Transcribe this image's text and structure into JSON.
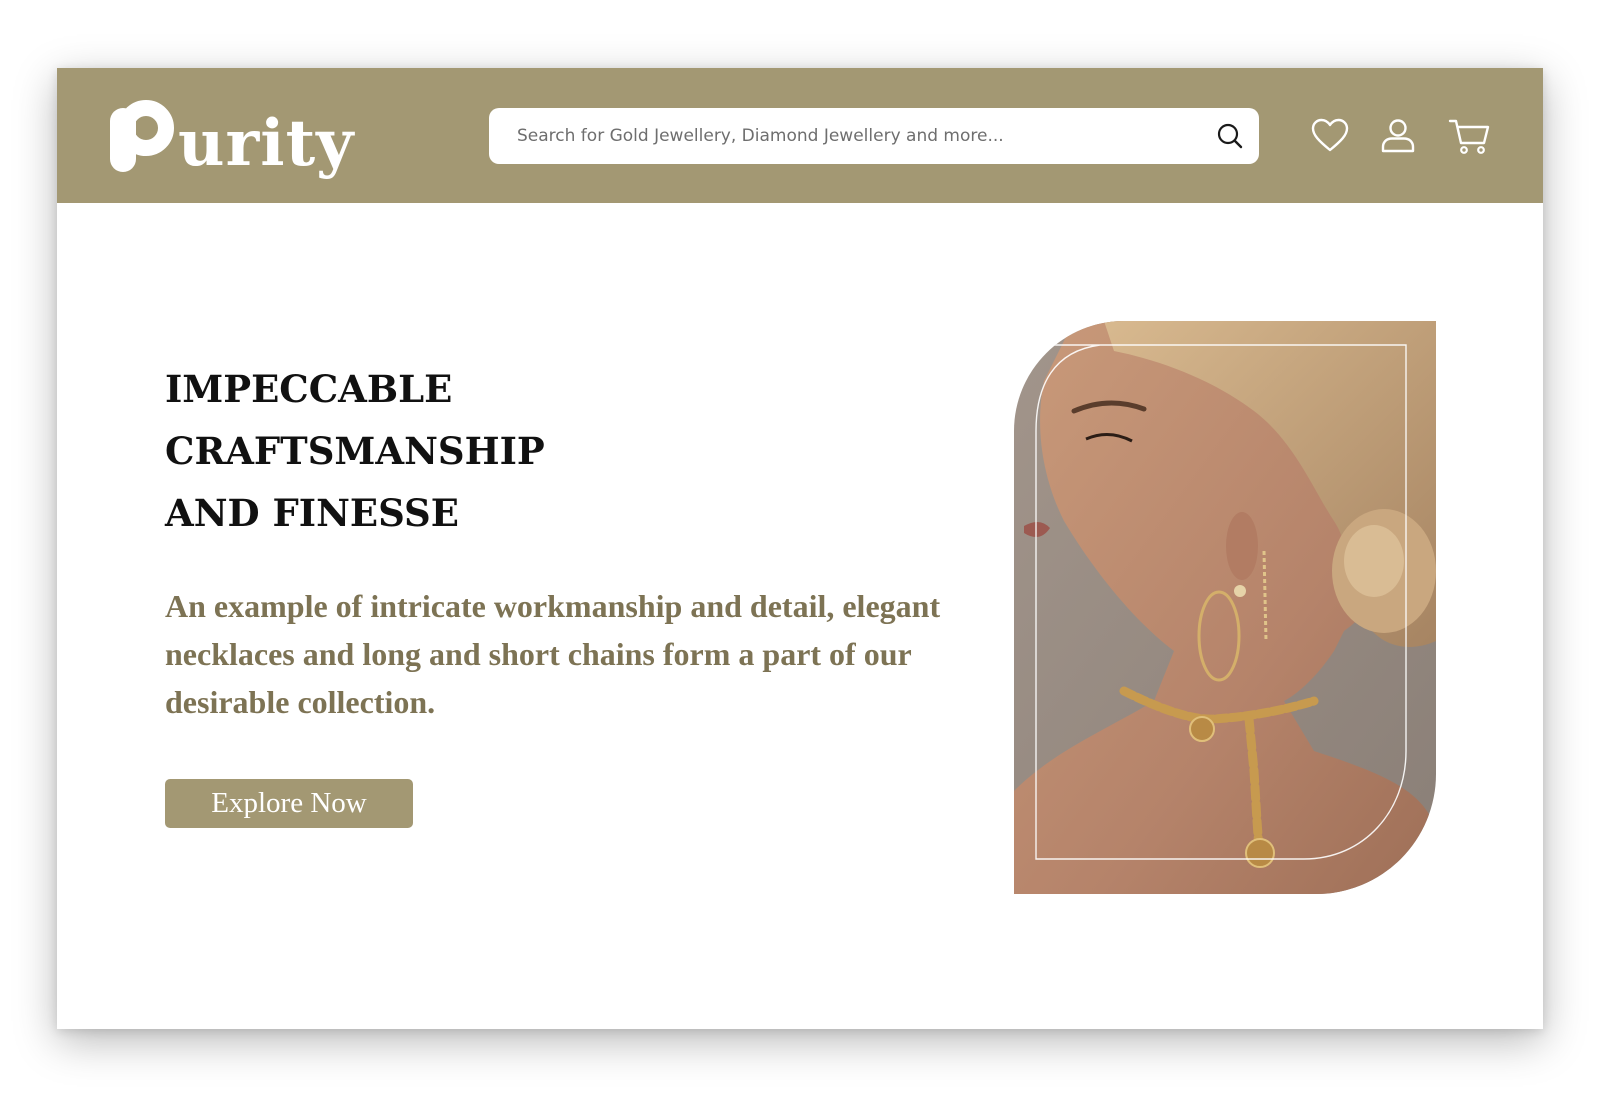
{
  "header": {
    "logo_text": "urity",
    "logo_mark": "P",
    "search_placeholder": "Search for Gold Jewellery, Diamond Jewellery and more...",
    "icons": [
      "search-icon",
      "heart-icon",
      "user-icon",
      "cart-icon"
    ]
  },
  "hero": {
    "headline": "IMPECCABLE CRAFTSMANSHIP AND FINESSE",
    "description": "An example of intricate workmanship and detail, elegant necklaces and long and short chains form a part of our desirable collection.",
    "cta_label": "Explore Now"
  },
  "colors": {
    "brand": "#a39873",
    "brand_text": "#7d7354",
    "heading": "#111111",
    "page_bg": "#ffffff"
  }
}
